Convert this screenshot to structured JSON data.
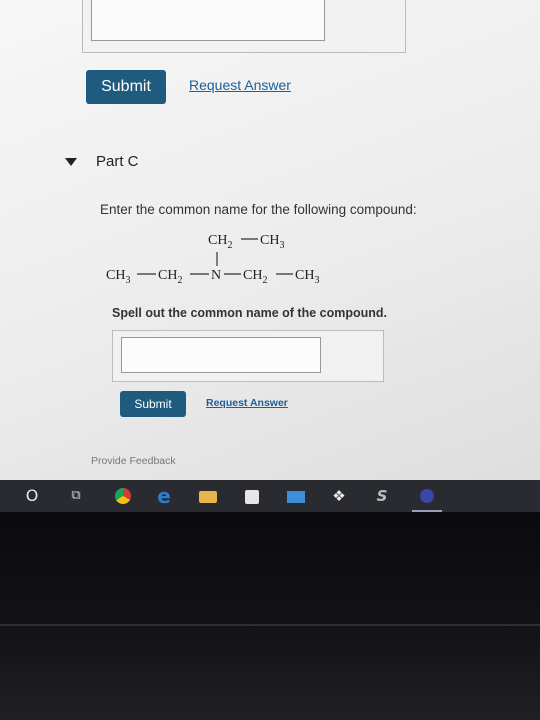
{
  "previous_part": {
    "submit_label": "Submit",
    "request_answer_label": "Request Answer"
  },
  "part_c": {
    "title": "Part C",
    "prompt": "Enter the common name for the following compound:",
    "structure": {
      "top": [
        "CH",
        "2",
        "CH",
        "3"
      ],
      "bottom": [
        "CH",
        "3",
        "CH",
        "2",
        "N",
        "CH",
        "2",
        "CH",
        "3"
      ]
    },
    "instruction": "Spell out the common name of the compound.",
    "answer_value": "",
    "submit_label": "Submit",
    "request_answer_label": "Request Answer"
  },
  "feedback_label": "Provide Feedback",
  "taskbar": {
    "icons": [
      "windows-start-icon",
      "task-view-icon",
      "chrome-icon",
      "edge-icon",
      "file-explorer-icon",
      "store-icon",
      "mail-icon",
      "dropbox-icon",
      "s-app-icon",
      "active-app-icon"
    ],
    "glyphs": {
      "start": "O",
      "task_view": "⧉",
      "edge": "e",
      "dropbox": "❖",
      "s": "S"
    }
  },
  "colors": {
    "primary_button": "#1f5a7f",
    "link": "#1c5f9a",
    "taskbar": "#2a2b30"
  }
}
